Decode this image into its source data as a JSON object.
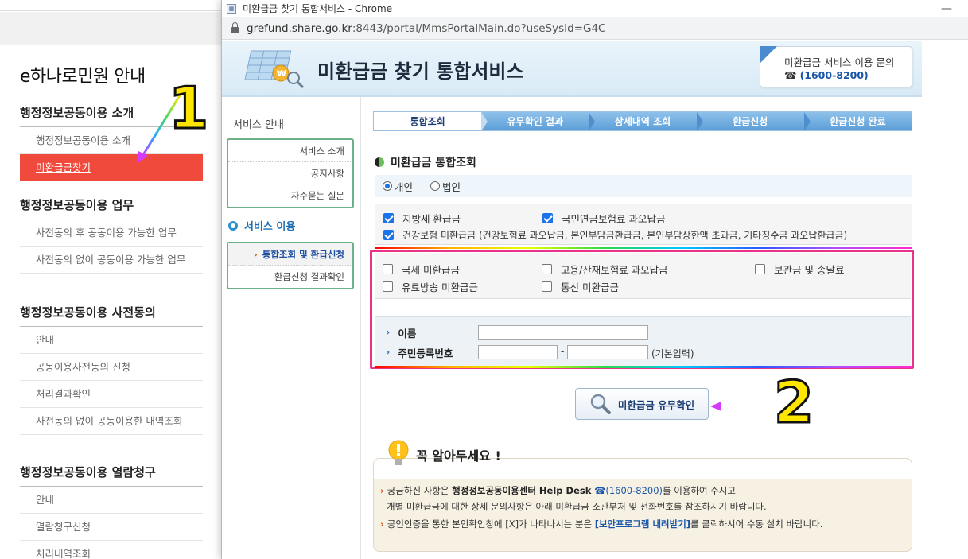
{
  "background_page": {
    "title": "e하나로민원 안내",
    "sections": [
      {
        "head": "행정정보공동이용 소개",
        "items": [
          "행정정보공동이용 소개",
          "미환급금찾기"
        ]
      },
      {
        "head": "행정정보공동이용 업무",
        "items": [
          "사전동의 후 공동이용 가능한 업무",
          "사전동의 없이 공동이용 가능한 업무"
        ]
      },
      {
        "head": "행정정보공동이용 사전동의",
        "items": [
          "안내",
          "공동이용사전동의 신청",
          "처리결과확인",
          "사전동의 없이 공동이용한 내역조회"
        ]
      },
      {
        "head": "행정정보공동이용 열람청구",
        "items": [
          "안내",
          "열람청구신청",
          "처리내역조회"
        ]
      }
    ]
  },
  "window": {
    "title": "미환급금 찾기 통합서비스 - Chrome",
    "url_host": "grefund.share.go.kr",
    "url_rest": ":8443/portal/MmsPortalMain.do?useSysId=G4C"
  },
  "header": {
    "title": "미환급금 찾기 통합서비스",
    "help_line1": "미환급금 서비스 이용 문의",
    "help_phone": "(1600-8200)"
  },
  "sidenav": {
    "guide_label": "서비스 안내",
    "guide_items": [
      "서비스 소개",
      "공지사항",
      "자주묻는 질문"
    ],
    "use_label": "서비스 이용",
    "use_items": [
      "통합조회 및 환급신청",
      "환급신청 결과확인"
    ]
  },
  "steps": [
    "통합조회",
    "유무확인 결과",
    "상세내역 조회",
    "환급신청",
    "환급신청 완료"
  ],
  "section_title": "미환급금 통합조회",
  "radios": {
    "personal": "개인",
    "corporate": "법인"
  },
  "checks_top": {
    "local_tax": "지방세 환급금",
    "pension": "국민연금보험료 과오납금",
    "health": "건강보험 미환급금 (건강보험료 과오납금, 본인부담금환급금, 본인부담상한액 초과금, 기타징수금 과오납환급금)"
  },
  "checks_bottom": {
    "national_tax": "국세 미환급금",
    "employment": "고용/산재보험료 과오납금",
    "deposit": "보관금 및 송달료",
    "broadcast": "유료방송 미환급금",
    "telecom": "통신 미환급금"
  },
  "form": {
    "name_label": "이름",
    "rrn_label": "주민등록번호",
    "dash": "-",
    "rrn_note": "(기본입력)"
  },
  "check_button": "미환급금 유무확인",
  "notice": {
    "title": "꼭 알아두세요 !",
    "l1_a": "궁금하신 사항은 ",
    "l1_b": "행정정보공동이용센터 Help Desk",
    "l1_c": "(1600-8200)",
    "l1_d": "를 이용하여 주시고",
    "l2": "개별 미환급금에 대한 상세 문의사항은 아래 미환급금 소관부처 및 전화번호를 참조하시기 바랍니다.",
    "l3_a": "공인인증을 통한 본인확인창에 [X]가 나타나시는 분은 ",
    "l3_b": "[보안프로그램 내려받기]",
    "l3_c": "를 클릭하시어 수동 설치 바랍니다."
  },
  "annotations": {
    "one": "1",
    "two": "2"
  },
  "colors": {
    "accent_red": "#f04a3c",
    "frame_pink": "#e83388",
    "step_blue": "#5c9fd8",
    "nav_green": "#6ab187"
  }
}
